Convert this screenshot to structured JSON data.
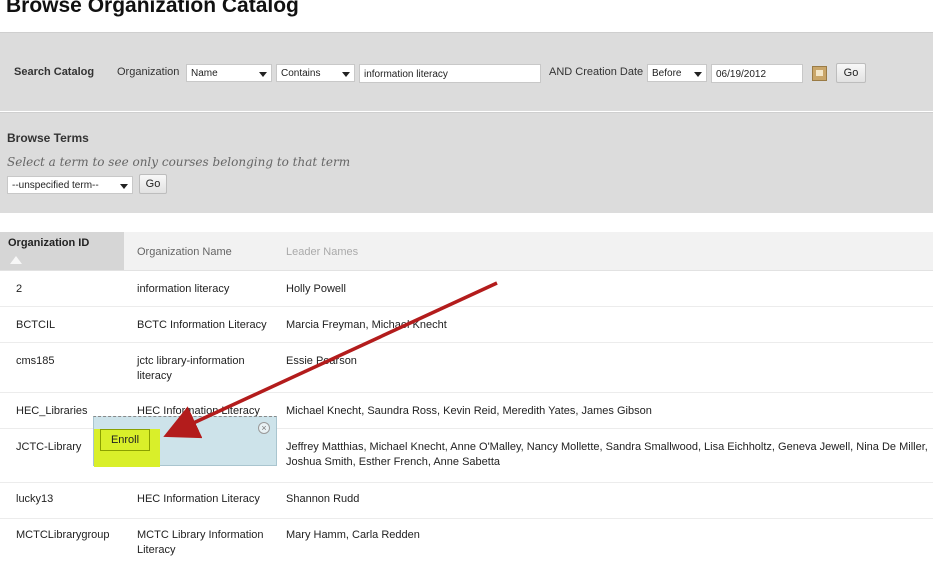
{
  "page": {
    "title": "Browse Organization Catalog"
  },
  "search": {
    "label": "Search Catalog",
    "field_label": "Organization",
    "field_select": "Name",
    "operator_select": "Contains",
    "query_value": "information literacy",
    "date_label": "AND Creation Date",
    "date_operator": "Before",
    "date_value": "06/19/2012",
    "go_label": "Go"
  },
  "browse_terms": {
    "heading": "Browse Terms",
    "hint": "Select a term to see only courses belonging to that term",
    "term_select": "--unspecified term--",
    "go_label": "Go"
  },
  "table": {
    "columns": {
      "id": "Organization ID",
      "name": "Organization Name",
      "leader": "Leader Names"
    },
    "rows": [
      {
        "id": "2",
        "name": "information literacy",
        "leader": "Holly Powell"
      },
      {
        "id": "BCTCIL",
        "name": "BCTC Information Literacy",
        "leader": "Marcia Freyman, Michael Knecht"
      },
      {
        "id": "cms185",
        "name": "jctc library-information literacy",
        "leader": "Essie Pearson"
      },
      {
        "id": "HEC_Libraries",
        "name": "HEC Information Literacy",
        "leader": "Michael Knecht, Saundra Ross, Kevin Reid, Meredith Yates, James Gibson"
      },
      {
        "id": "JCTC-Library",
        "name": "",
        "leader": "Jeffrey Matthias, Michael Knecht, Anne O'Malley, Nancy Mollette, Sandra Smallwood, Lisa Eichholtz, Geneva Jewell, Nina De Miller, Joshua Smith, Esther French, Anne Sabetta"
      },
      {
        "id": "lucky13",
        "name": "HEC Information Literacy",
        "leader": "Shannon Rudd"
      },
      {
        "id": "MCTCLibrarygroup",
        "name": "MCTC Library Information Literacy",
        "leader": "Mary Hamm, Carla Redden"
      }
    ]
  },
  "popup": {
    "enroll_label": "Enroll",
    "close_icon": "close-circle-icon"
  },
  "annotation": {
    "arrow_color": "#b31c1c",
    "highlight_color": "#d9ef2a"
  }
}
